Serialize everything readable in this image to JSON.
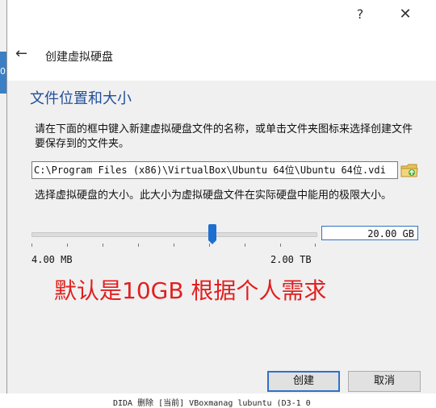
{
  "background": {
    "left_edge_text": "0",
    "bottom_text": "DIDA  删除   [当前]  VBoxmanag  lubuntu  (D3-1 0"
  },
  "titlebar": {
    "help_label": "?",
    "close_label": "✕"
  },
  "wizard": {
    "back_label": "←",
    "title": "创建虚拟硬盘"
  },
  "location": {
    "section_title": "文件位置和大小",
    "description": "请在下面的框中键入新建虚拟硬盘文件的名称，或单击文件夹图标来选择创建文件要保存到的文件夹。",
    "path_value": "C:\\Program Files (x86)\\VirtualBox\\Ubuntu 64位\\Ubuntu 64位.vdi"
  },
  "size": {
    "description": "选择虚拟硬盘的大小。此大小为虚拟硬盘文件在实际硬盘中能用的极限大小。",
    "value": "20.00 GB",
    "min_label": "4.00 MB",
    "max_label": "2.00 TB",
    "slider_fraction": 0.64
  },
  "annotation": {
    "text": "默认是10GB 根据个人需求",
    "color": "#e02020"
  },
  "buttons": {
    "create": "创建",
    "cancel": "取消"
  },
  "colors": {
    "accent": "#2e72c8",
    "title_blue": "#1f4e9a"
  }
}
